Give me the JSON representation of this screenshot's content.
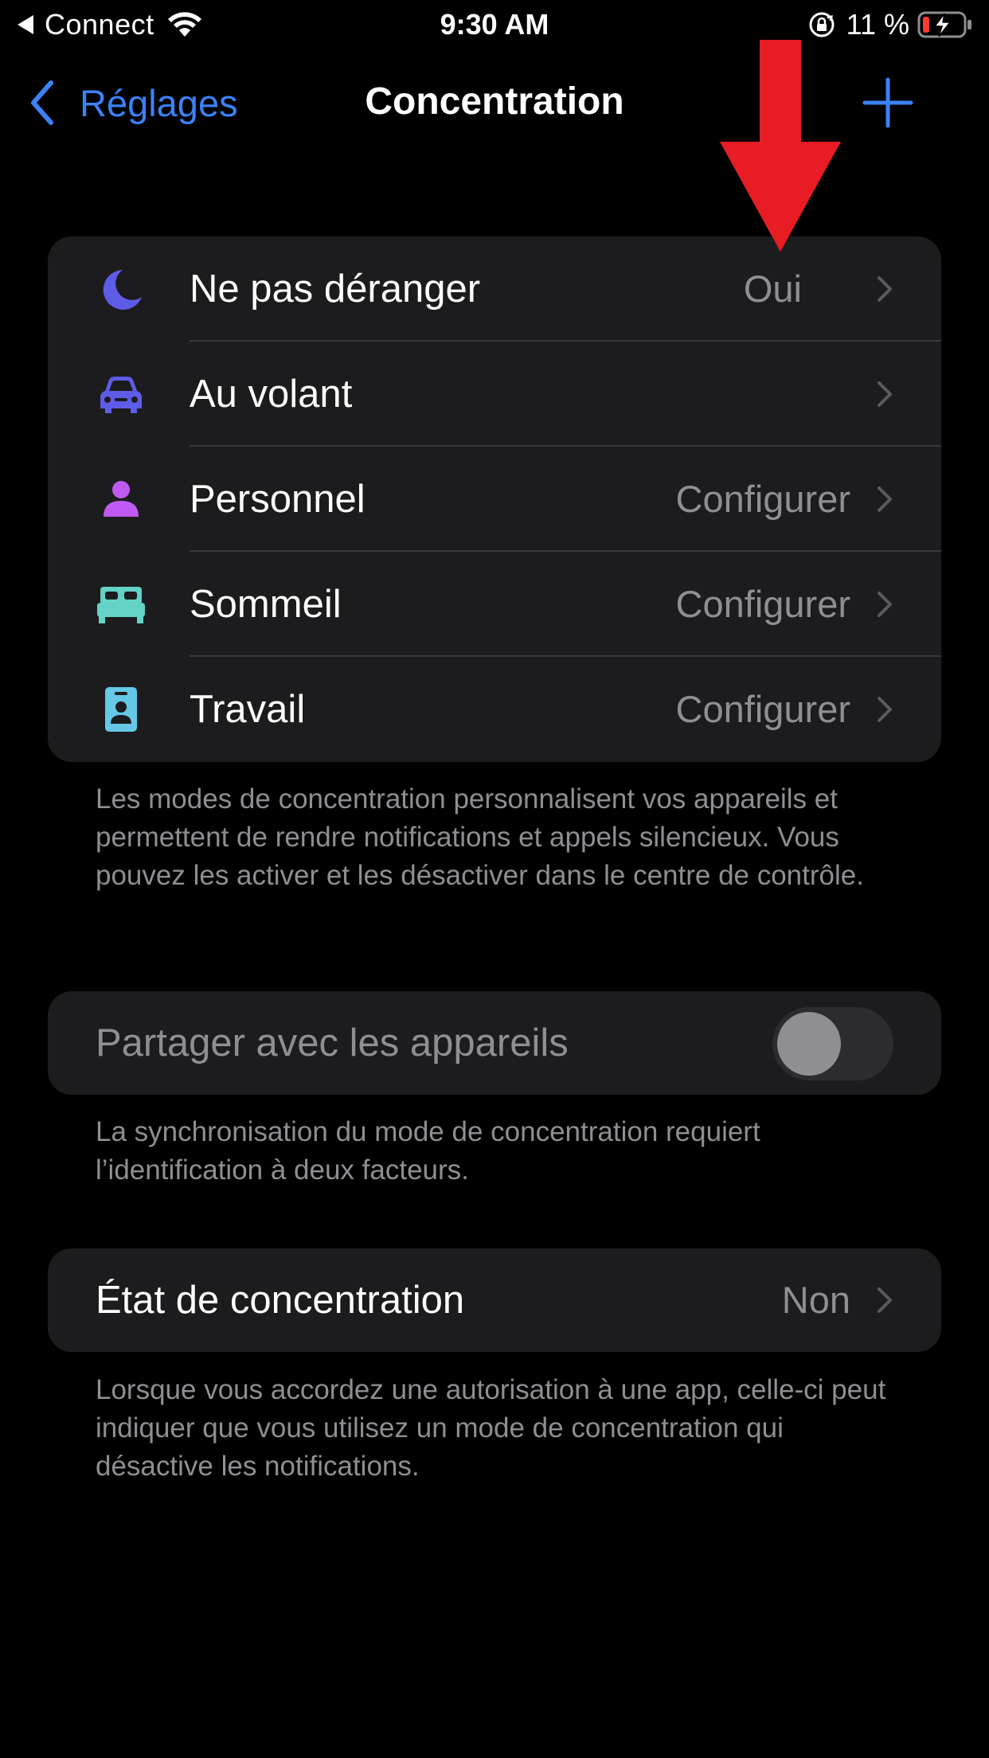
{
  "status_bar": {
    "carrier": "Connect",
    "time": "9:30 AM",
    "battery_percent": "11 %",
    "icons": [
      "back-triangle-icon",
      "wifi-icon",
      "orientation-lock-icon",
      "battery-charging-icon"
    ]
  },
  "nav": {
    "back_label": "Réglages",
    "title": "Concentration",
    "add_icon": "plus-icon"
  },
  "focus_modes": [
    {
      "label": "Ne pas déranger",
      "value": "Oui",
      "icon": "moon-icon",
      "color": "#5e5ce6"
    },
    {
      "label": "Au volant",
      "value": "",
      "icon": "car-icon",
      "color": "#5e5ce6"
    },
    {
      "label": "Personnel",
      "value": "Configurer",
      "icon": "person-icon",
      "color": "#bf5af2"
    },
    {
      "label": "Sommeil",
      "value": "Configurer",
      "icon": "bed-icon",
      "color": "#64d2c6"
    },
    {
      "label": "Travail",
      "value": "Configurer",
      "icon": "id-badge-icon",
      "color": "#64c8e6"
    }
  ],
  "focus_footnote": "Les modes de concentration personnalisent vos appareils et permettent de rendre notifications et appels silencieux. Vous pouvez les activer et les désactiver dans le centre de contrôle.",
  "share": {
    "label": "Partager avec les appareils",
    "enabled": false
  },
  "share_footnote": "La synchronisation du mode de concentration requiert l’identification à deux facteurs.",
  "focus_status": {
    "label": "État de concentration",
    "value": "Non"
  },
  "status_footnote": "Lorsque vous accordez une autorisation à une app, celle-ci peut indiquer que vous utilisez un mode de concentration qui désactive les notifications.",
  "colors": {
    "accent": "#3b82f6",
    "annotation_arrow": "#e81c24",
    "cell_bg": "#1c1c1e",
    "secondary_text": "#8e8e93"
  }
}
